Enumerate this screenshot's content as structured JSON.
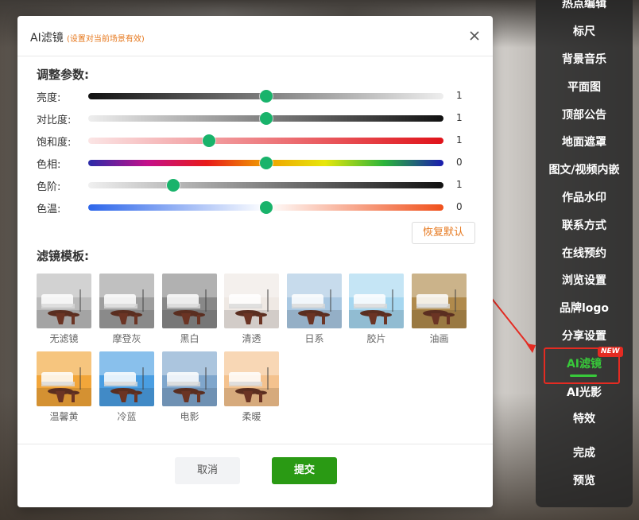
{
  "dialog": {
    "title": "AI滤镜",
    "subtitle": "(设置对当前场景有效)",
    "close_icon": "close-icon"
  },
  "adjust": {
    "section_title": "调整参数:",
    "sliders": [
      {
        "label": "亮度:",
        "value": "1",
        "position": 0.5,
        "gradient": [
          "#111111",
          "#eeeeee"
        ]
      },
      {
        "label": "对比度:",
        "value": "1",
        "position": 0.5,
        "gradient": [
          "#eeeeee",
          "#111111"
        ]
      },
      {
        "label": "饱和度:",
        "value": "1",
        "position": 0.34,
        "gradient": [
          "#fbe5e5",
          "#e0131a"
        ]
      },
      {
        "label": "色相:",
        "value": "0",
        "position": 0.5,
        "gradient": [
          "#2a2aa8",
          "#c4108a",
          "#e81a1a",
          "#f0a000",
          "#e7e70a",
          "#2ab43a",
          "#1a1ab0"
        ]
      },
      {
        "label": "色阶:",
        "value": "1",
        "position": 0.24,
        "gradient": [
          "#f0f0f0",
          "#111111"
        ]
      },
      {
        "label": "色温:",
        "value": "0",
        "position": 0.5,
        "gradient": [
          "#2d66ea",
          "#ffffff",
          "#f0501b"
        ]
      }
    ],
    "reset_label": "恢复默认"
  },
  "filters": {
    "section_title": "滤镜模板:",
    "items": [
      {
        "label": "无滤镜",
        "tint": "#bbbbbb"
      },
      {
        "label": "摩登灰",
        "tint": "#9e9e9e"
      },
      {
        "label": "黑白",
        "tint": "#888888"
      },
      {
        "label": "清透",
        "tint": "#efe9e4"
      },
      {
        "label": "日系",
        "tint": "#a9c8e2"
      },
      {
        "label": "胶片",
        "tint": "#a6d7f0"
      },
      {
        "label": "油画",
        "tint": "#b08a4c"
      },
      {
        "label": "温馨黄",
        "tint": "#f2a63a"
      },
      {
        "label": "冷蓝",
        "tint": "#4a9ee2"
      },
      {
        "label": "电影",
        "tint": "#7fa6cc"
      },
      {
        "label": "柔暖",
        "tint": "#f4c28e"
      }
    ]
  },
  "footer": {
    "cancel_label": "取消",
    "submit_label": "提交"
  },
  "side_menu": {
    "items": [
      "热点编辑",
      "标尺",
      "背景音乐",
      "平面图",
      "顶部公告",
      "地面遮罩",
      "图文/视频内嵌",
      "作品水印",
      "联系方式",
      "在线预约",
      "浏览设置",
      "品牌logo",
      "分享设置",
      "AI滤镜",
      "AI光影",
      "特效",
      "完成",
      "预览"
    ],
    "active_item": "AI滤镜",
    "new_badge": "NEW"
  },
  "colors": {
    "accent_green": "#2a9a14",
    "slider_thumb": "#19b36b",
    "highlight_red": "#e42b22",
    "subtitle_orange": "#e6781e",
    "menu_active": "#38c93a"
  }
}
